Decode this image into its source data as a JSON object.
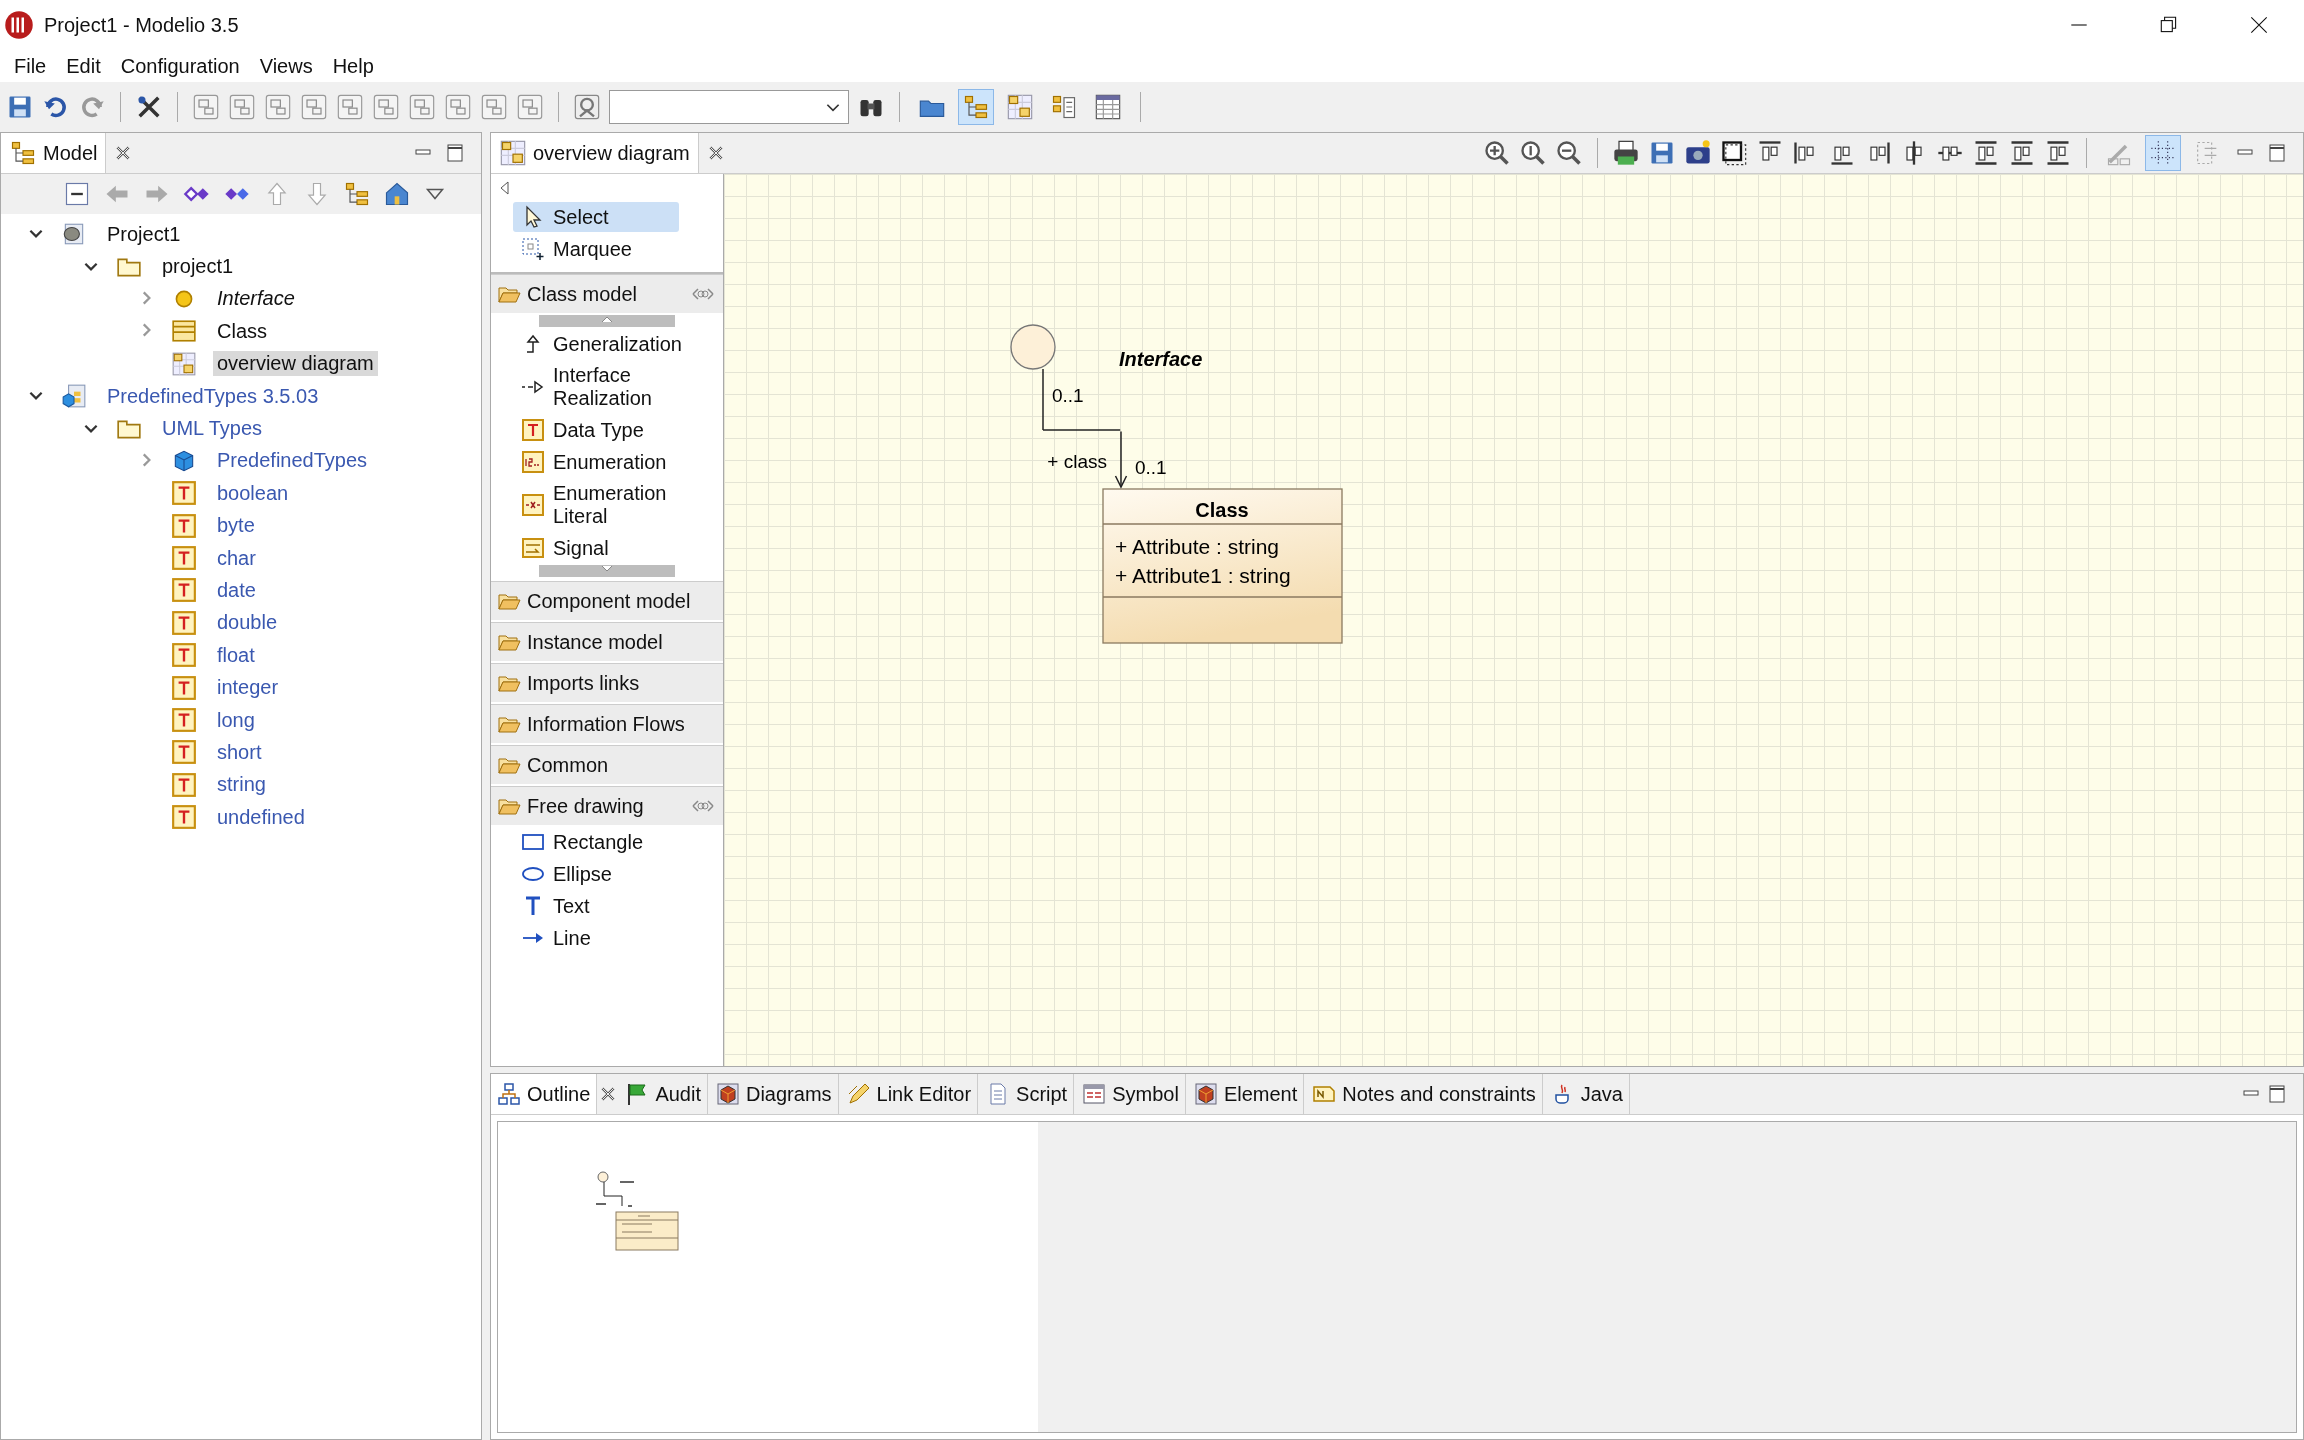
{
  "window": {
    "title": "Project1 - Modelio 3.5"
  },
  "menu": [
    "File",
    "Edit",
    "Configuration",
    "Views",
    "Help"
  ],
  "main_toolbar": {
    "view_toggles": [
      {
        "on": false
      },
      {
        "on": true
      },
      {
        "on": false
      },
      {
        "on": false
      },
      {
        "on": false
      }
    ]
  },
  "model_panel": {
    "tab": "Model",
    "tree": [
      {
        "kind": "project",
        "label": "Project1",
        "expanded": true,
        "selected": false,
        "readonly": false,
        "children": [
          {
            "kind": "package",
            "label": "project1",
            "expanded": true,
            "selected": false,
            "readonly": false,
            "children": [
              {
                "kind": "interface",
                "label": "Interface",
                "expanded": false,
                "selected": false,
                "readonly": false
              },
              {
                "kind": "class",
                "label": "Class",
                "expanded": false,
                "selected": false,
                "readonly": false
              },
              {
                "kind": "diagram",
                "label": "overview diagram",
                "selected": true,
                "readonly": false
              }
            ]
          }
        ]
      },
      {
        "kind": "module",
        "label": "PredefinedTypes 3.5.03",
        "expanded": true,
        "selected": false,
        "readonly": true,
        "children": [
          {
            "kind": "package",
            "label": "UML Types",
            "expanded": true,
            "selected": false,
            "readonly": true,
            "children": [
              {
                "kind": "cube",
                "label": "PredefinedTypes",
                "expanded": false,
                "selected": false,
                "readonly": true
              },
              {
                "kind": "datatype",
                "label": "boolean",
                "selected": false,
                "readonly": true
              },
              {
                "kind": "datatype",
                "label": "byte",
                "selected": false,
                "readonly": true
              },
              {
                "kind": "datatype",
                "label": "char",
                "selected": false,
                "readonly": true
              },
              {
                "kind": "datatype",
                "label": "date",
                "selected": false,
                "readonly": true
              },
              {
                "kind": "datatype",
                "label": "double",
                "selected": false,
                "readonly": true
              },
              {
                "kind": "datatype",
                "label": "float",
                "selected": false,
                "readonly": true
              },
              {
                "kind": "datatype",
                "label": "integer",
                "selected": false,
                "readonly": true
              },
              {
                "kind": "datatype",
                "label": "long",
                "selected": false,
                "readonly": true
              },
              {
                "kind": "datatype",
                "label": "short",
                "selected": false,
                "readonly": true
              },
              {
                "kind": "datatype",
                "label": "string",
                "selected": false,
                "readonly": true
              },
              {
                "kind": "datatype",
                "label": "undefined",
                "selected": false,
                "readonly": true
              }
            ]
          }
        ]
      }
    ]
  },
  "editor": {
    "tab": "overview diagram",
    "diagram_toolbar": {
      "toggles": [
        {
          "on": false
        },
        {
          "on": true
        },
        {
          "on": false
        }
      ]
    },
    "palette": {
      "tools": [
        {
          "kind": "pointer",
          "label": "Select",
          "selected": true
        },
        {
          "kind": "marquee",
          "label": "Marquee",
          "selected": false
        }
      ],
      "drawers": [
        {
          "label": "Class model",
          "expanded": true,
          "scrolled": true,
          "items": [
            {
              "kind": "generalization",
              "label": "Generalization"
            },
            {
              "kind": "realization",
              "label": "Interface Realization"
            },
            {
              "kind": "datatype",
              "label": "Data Type"
            },
            {
              "kind": "enumeration",
              "label": "Enumeration"
            },
            {
              "kind": "literal",
              "label": "Enumeration Literal"
            },
            {
              "kind": "signal",
              "label": "Signal"
            }
          ]
        },
        {
          "label": "Component model",
          "expanded": false
        },
        {
          "label": "Instance model",
          "expanded": false
        },
        {
          "label": "Imports links",
          "expanded": false
        },
        {
          "label": "Information Flows",
          "expanded": false
        },
        {
          "label": "Common",
          "expanded": false
        },
        {
          "label": "Free drawing",
          "expanded": true,
          "scrolled": false,
          "items": [
            {
              "kind": "rectangle",
              "label": "Rectangle"
            },
            {
              "kind": "ellipse",
              "label": "Ellipse"
            },
            {
              "kind": "text",
              "label": "Text"
            },
            {
              "kind": "line",
              "label": "Line"
            }
          ]
        }
      ]
    },
    "diagram": {
      "interface": {
        "name": "Interface"
      },
      "association": {
        "source_multiplicity": "0..1",
        "role": "+ class",
        "target_multiplicity": "0..1"
      },
      "class": {
        "name": "Class",
        "attributes": [
          "+ Attribute : string",
          "+ Attribute1 : string"
        ]
      }
    }
  },
  "bottom_panel": {
    "tabs": [
      {
        "kind": "outline",
        "label": "Outline",
        "selected": true
      },
      {
        "kind": "audit",
        "label": "Audit",
        "selected": false
      },
      {
        "kind": "diagrams",
        "label": "Diagrams",
        "selected": false
      },
      {
        "kind": "link",
        "label": "Link Editor",
        "selected": false
      },
      {
        "kind": "script",
        "label": "Script",
        "selected": false
      },
      {
        "kind": "symbol",
        "label": "Symbol",
        "selected": false
      },
      {
        "kind": "element",
        "label": "Element",
        "selected": false
      },
      {
        "kind": "notes",
        "label": "Notes and constraints",
        "selected": false
      },
      {
        "kind": "java",
        "label": "Java",
        "selected": false
      }
    ]
  }
}
